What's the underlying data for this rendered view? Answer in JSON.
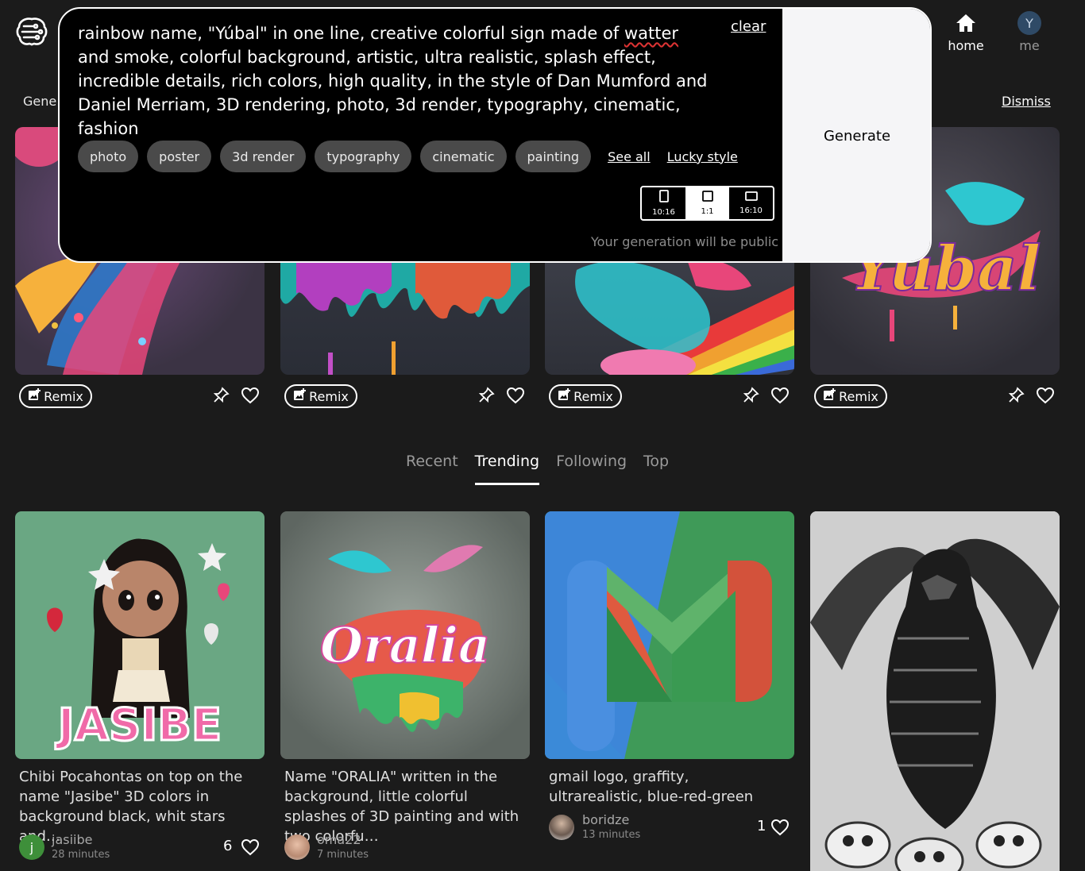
{
  "header": {
    "nav_home": "home",
    "nav_me": "me",
    "avatar_initial": "Y",
    "gene_label": "Gene",
    "dismiss": "Dismiss"
  },
  "prompt": {
    "text_before": "rainbow name, \"Yúbal\" in one line, creative colorful sign made of ",
    "text_misspelled": "watter",
    "text_after": " and smoke, colorful background, artistic, ultra realistic, splash effect, incredible details, rich colors, high quality, in the style of Dan Mumford and Daniel Merriam, 3D rendering, photo, 3d render, typography, cinematic, fashion",
    "clear": "clear",
    "chips": [
      "photo",
      "poster",
      "3d render",
      "typography",
      "cinematic",
      "painting"
    ],
    "see_all": "See all",
    "lucky_style": "Lucky style",
    "aspects": [
      "10:16",
      "1:1",
      "16:10"
    ],
    "aspect_selected": "1:1",
    "public_note": "Your generation will be public",
    "generate": "Generate"
  },
  "featured": {
    "remix_label": "Remix"
  },
  "tabs": [
    "Recent",
    "Trending",
    "Following",
    "Top"
  ],
  "active_tab": "Trending",
  "feed": [
    {
      "caption": "Chibi Pocahontas on top on the name \"Jasibe\" 3D colors in background black, whit stars and…",
      "user": "jasiibe",
      "time": "28 minutes",
      "likes": "6",
      "avatar_initial": "j"
    },
    {
      "caption": "Name \"ORALIA\" written in the background, little colorful splashes of 3D painting and with two colorfu…",
      "user": "oma22",
      "time": "7 minutes",
      "likes": ""
    },
    {
      "caption": "gmail logo, graffity, ultrarealistic, blue-red-green",
      "user": "boridze",
      "time": "13 minutes",
      "likes": "1"
    },
    {
      "caption": "",
      "user": "",
      "time": "",
      "likes": ""
    }
  ],
  "image_text": {
    "jasibe": "JASIBE",
    "oralia": "Oralia",
    "yubal": "Yúbal"
  },
  "colors": {
    "background": "#1b1b1b",
    "panel": "#000000",
    "chip": "#4a4a4a",
    "generate_bg": "#f5f5f7",
    "muted": "#9a9a9a"
  },
  "icons": [
    "brain-logo-icon",
    "home-icon",
    "image-plus-icon",
    "pin-icon",
    "heart-icon",
    "portrait-aspect-icon",
    "square-aspect-icon",
    "landscape-aspect-icon"
  ]
}
